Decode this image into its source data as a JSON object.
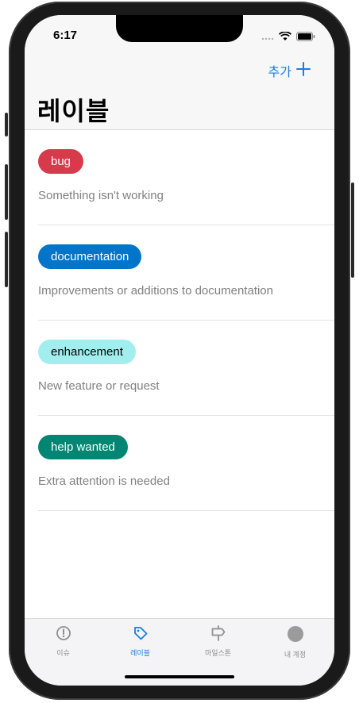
{
  "status_bar": {
    "time": "6:17"
  },
  "header": {
    "add_label": "추가",
    "title": "레이블"
  },
  "labels": [
    {
      "name": "bug",
      "description": "Something isn't working",
      "color": "#d73a4a",
      "text_color": "#ffffff"
    },
    {
      "name": "documentation",
      "description": "Improvements or additions to documentation",
      "color": "#0075ca",
      "text_color": "#ffffff"
    },
    {
      "name": "enhancement",
      "description": "New feature or request",
      "color": "#a2eeef",
      "text_color": "#000000"
    },
    {
      "name": "help wanted",
      "description": "Extra attention is needed",
      "color": "#008672",
      "text_color": "#ffffff"
    }
  ],
  "tabbar": {
    "tabs": [
      {
        "label": "이슈",
        "icon": "issue-icon",
        "active": false
      },
      {
        "label": "레이블",
        "icon": "tag-icon",
        "active": true
      },
      {
        "label": "마일스톤",
        "icon": "milestone-icon",
        "active": false
      },
      {
        "label": "내 계정",
        "icon": "avatar-icon",
        "active": false
      }
    ]
  },
  "colors": {
    "accent": "#1b7de0",
    "inactive": "#8e8e93"
  }
}
